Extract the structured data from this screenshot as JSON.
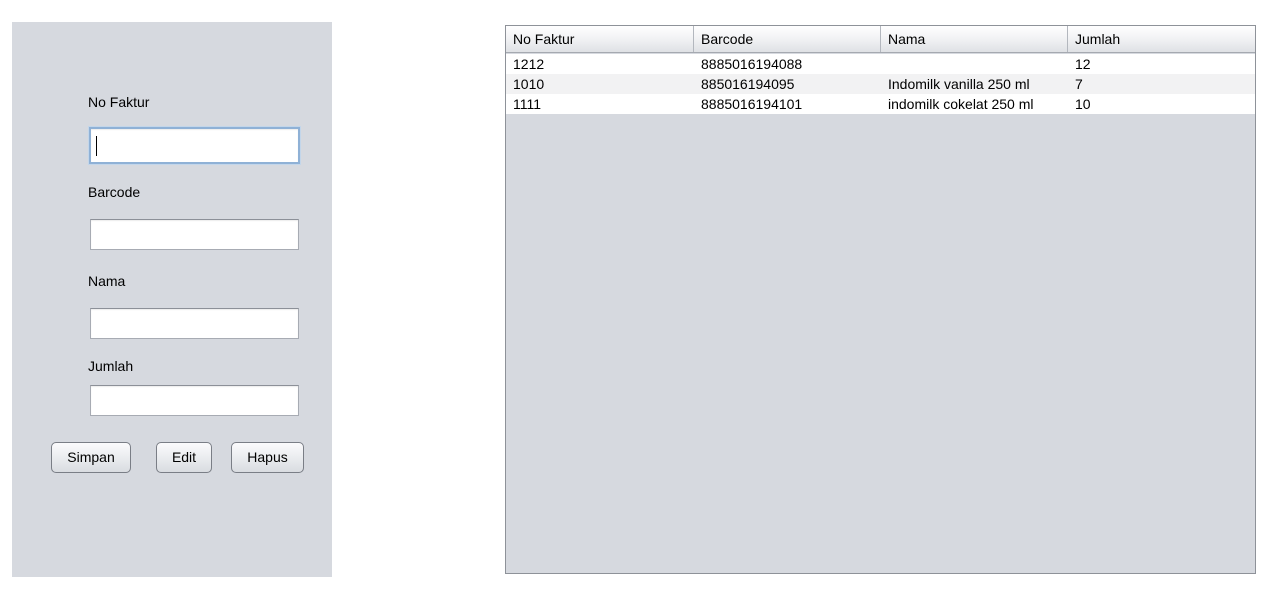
{
  "form": {
    "fields": [
      {
        "label": "No Faktur",
        "value": "",
        "focused": true
      },
      {
        "label": "Barcode",
        "value": ""
      },
      {
        "label": "Nama",
        "value": ""
      },
      {
        "label": "Jumlah",
        "value": ""
      }
    ],
    "buttons": {
      "save_label": "Simpan",
      "edit_label": "Edit",
      "delete_label": "Hapus"
    }
  },
  "table": {
    "columns": [
      "No Faktur",
      "Barcode",
      "Nama",
      "Jumlah"
    ],
    "rows": [
      [
        "1212",
        "8885016194088",
        "",
        "12"
      ],
      [
        "1010",
        "885016194095",
        "Indomilk vanilla 250 ml",
        "7"
      ],
      [
        "1111",
        "8885016194101",
        "indomilk cokelat 250 ml",
        "10"
      ]
    ]
  },
  "colors": {
    "panel_background": "#d6d9df",
    "focus_border": "#8fb1d6"
  }
}
